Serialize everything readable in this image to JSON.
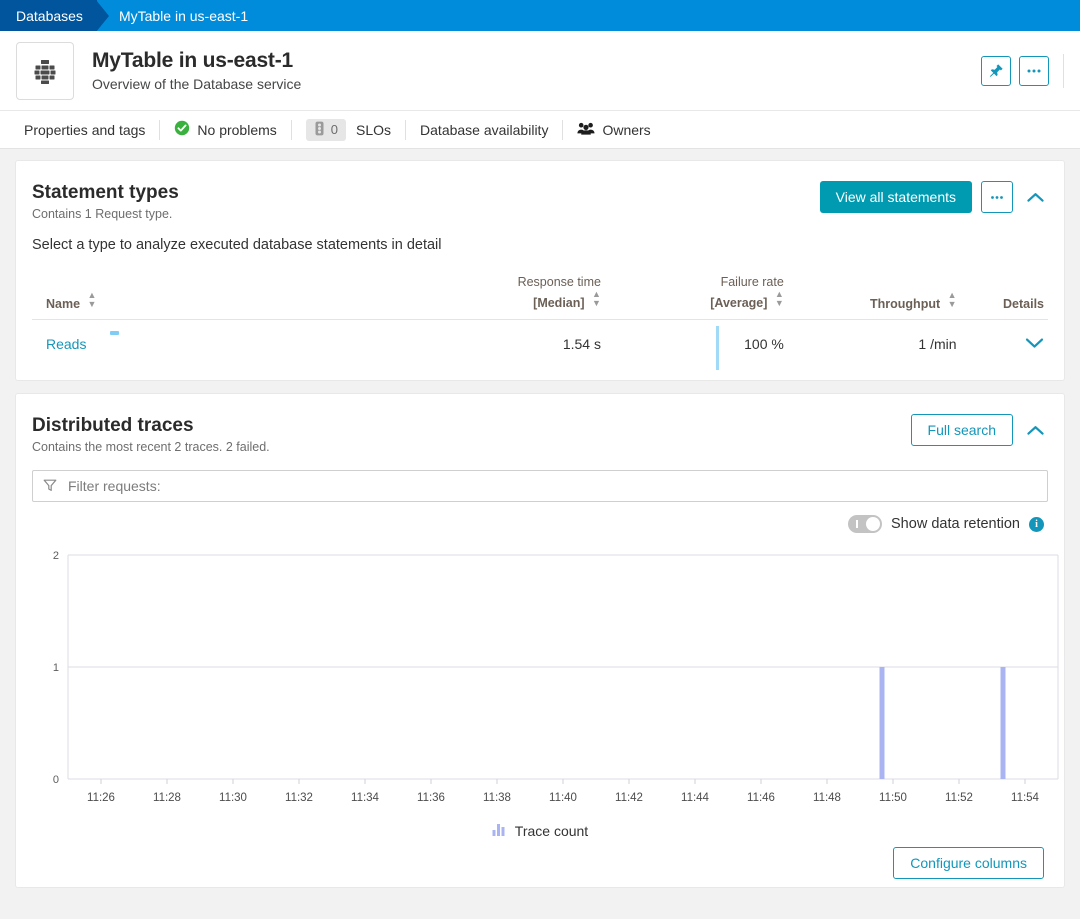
{
  "breadcrumb": {
    "root": "Databases",
    "current": "MyTable in us-east-1"
  },
  "header": {
    "title": "MyTable in us-east-1",
    "subtitle": "Overview of the Database service",
    "icon": "database-grid-icon",
    "actions": [
      {
        "name": "pin-button",
        "icon": "pin-icon"
      },
      {
        "name": "more-actions-button",
        "icon": "ellipsis-icon"
      }
    ]
  },
  "subnav": {
    "items": [
      {
        "label": "Properties and tags",
        "icon": null
      },
      {
        "label": "No problems",
        "icon": "check-circle-icon"
      },
      {
        "label": "SLOs",
        "icon": "traffic-light-icon",
        "badge": "0"
      },
      {
        "label": "Database availability",
        "icon": null
      },
      {
        "label": "Owners",
        "icon": "people-icon"
      }
    ]
  },
  "statement_types": {
    "title": "Statement types",
    "subtitle": "Contains 1 Request type.",
    "description": "Select a type to analyze executed database statements in detail",
    "view_all_label": "View all statements",
    "more_label": "•••",
    "collapse_icon": "chevron-up-icon",
    "columns": {
      "name": "Name",
      "response_time_line1": "Response time",
      "response_time_line2": "[Median]",
      "failure_rate_line1": "Failure rate",
      "failure_rate_line2": "[Average]",
      "throughput": "Throughput",
      "details": "Details"
    },
    "rows": [
      {
        "name": "Reads",
        "response_time": "1.54 s",
        "failure_rate": "100 %",
        "throughput": "1 /min",
        "expand_icon": "chevron-down-icon"
      }
    ]
  },
  "distributed_traces": {
    "title": "Distributed traces",
    "subtitle": "Contains the most recent 2 traces. 2 failed.",
    "full_search_label": "Full search",
    "collapse_icon": "chevron-up-icon",
    "filter": {
      "placeholder": "Filter requests:",
      "value": "",
      "icon": "funnel-icon"
    },
    "retention_toggle": {
      "label": "Show data retention",
      "state": "off",
      "info_icon": "info-icon"
    },
    "legend_label": "Trace count",
    "legend_icon": "bar-chart-icon",
    "configure_columns_label": "Configure columns"
  },
  "colors": {
    "breadcrumb_root": "#00559c",
    "breadcrumb_bg": "#008cdb",
    "accent_teal": "#1496ba",
    "primary_button": "#009bb0",
    "bar_fill": "#aab4f3",
    "sparkline": "#8fd4f5",
    "ok_green": "#3ab03e"
  },
  "chart_data": {
    "type": "bar",
    "title": "",
    "xlabel": "",
    "ylabel": "",
    "ylim": [
      0,
      2
    ],
    "yticks": [
      0,
      1,
      2
    ],
    "grid": true,
    "legend": [
      "Trace count"
    ],
    "legend_position": "bottom",
    "xticks": [
      "11:26",
      "11:28",
      "11:30",
      "11:32",
      "11:34",
      "11:36",
      "11:38",
      "11:40",
      "11:42",
      "11:44",
      "11:46",
      "11:48",
      "11:50",
      "11:52",
      "11:54"
    ],
    "x_range": [
      "11:25",
      "11:55"
    ],
    "series": [
      {
        "name": "Trace count",
        "points": [
          {
            "x": "11:49:40",
            "y": 1
          },
          {
            "x": "11:53:20",
            "y": 1
          }
        ]
      }
    ]
  }
}
